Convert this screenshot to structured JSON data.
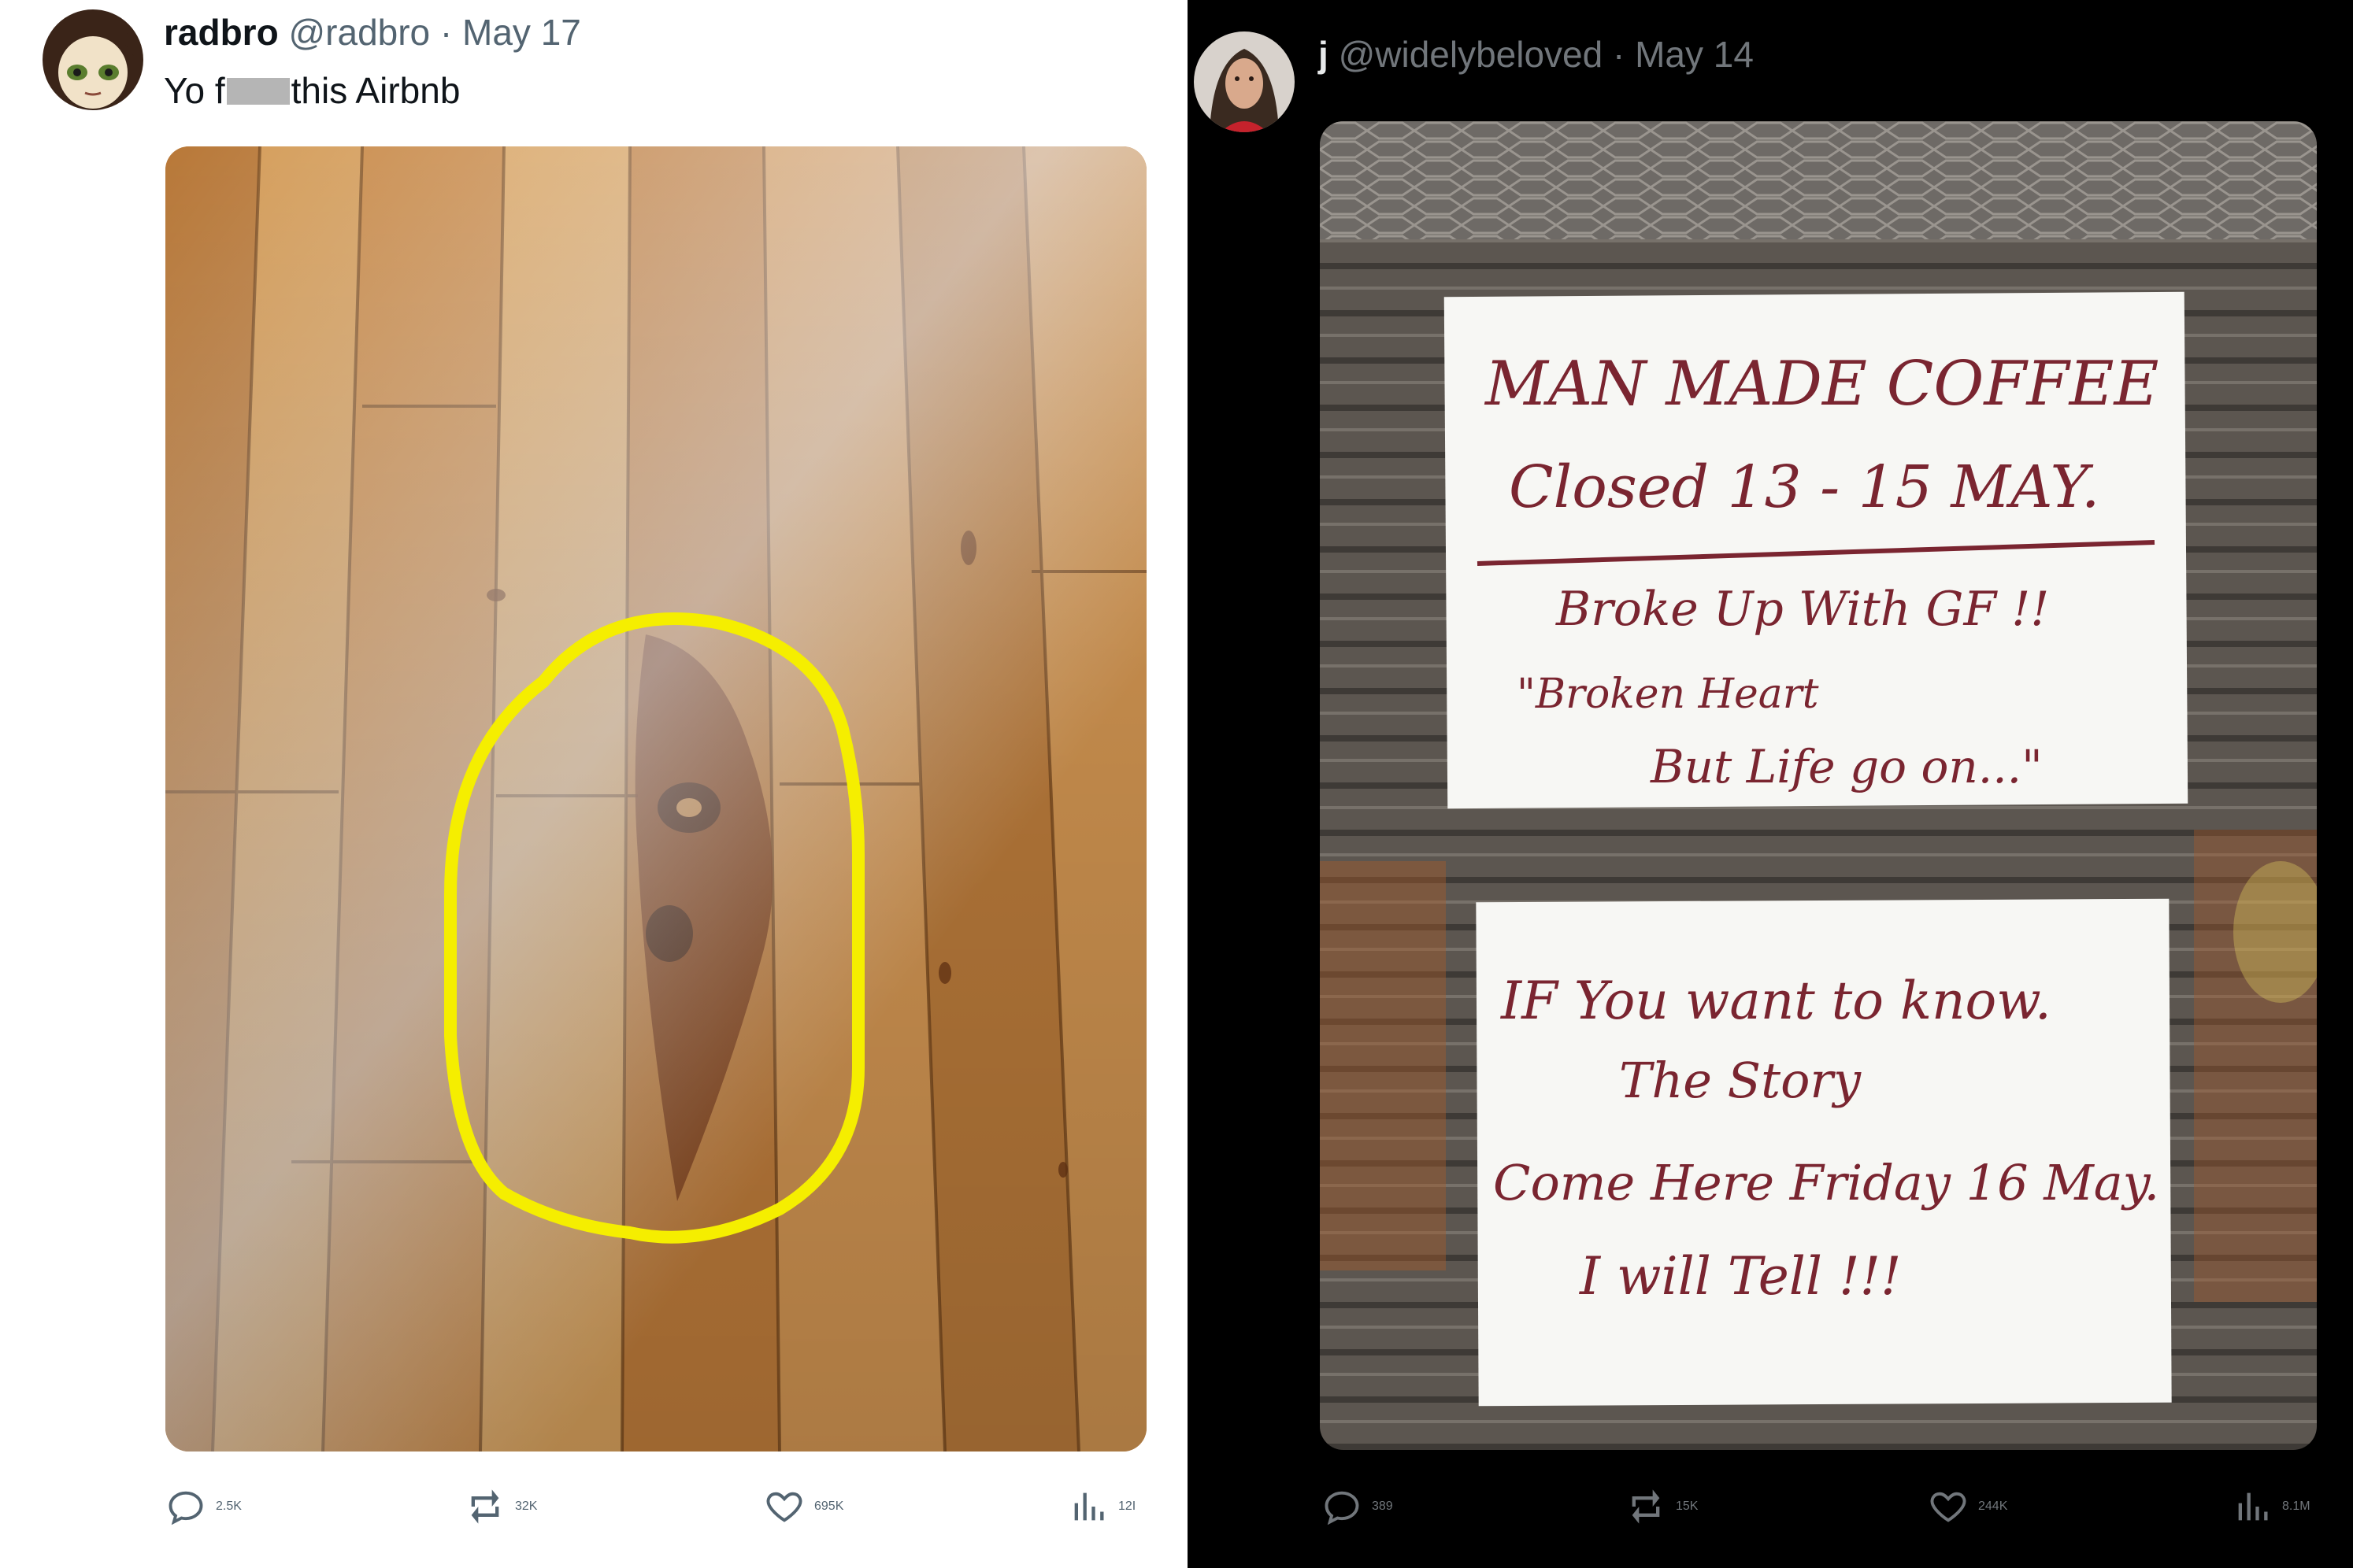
{
  "left_tweet": {
    "display_name": "radbro",
    "handle": "@radbro",
    "date": "· May 17",
    "text_before": "Yo f",
    "text_after": "this Airbnb",
    "image_alt": "Wood plank floor with a yellow-circled knot that looks like a face",
    "actions": {
      "replies": "2.5K",
      "reposts": "32K",
      "likes": "695K",
      "views": "12I"
    }
  },
  "right_tweet": {
    "display_name": "j",
    "handle": "@widelybeloved",
    "date": "· May 14",
    "sign_top": {
      "line1": "MAN MADE COFFEE",
      "line2": "Closed 13 - 15 MAY.",
      "line3": "Broke Up With GF !!",
      "line4": "\"Broken Heart",
      "line5": "But Life go on...\""
    },
    "sign_bottom": {
      "line1": "IF You want to know.",
      "line2": "The Story",
      "line3": "Come Here Friday 16 May.",
      "line4": "I will Tell !!!"
    },
    "actions": {
      "replies": "389",
      "reposts": "15K",
      "likes": "244K",
      "views": "8.1M"
    }
  },
  "colors": {
    "highlight_circle": "#f5ee00",
    "ink": "#7a2530",
    "wood": "#c98a45"
  },
  "icons": {
    "reply": "reply-icon",
    "repost": "repost-icon",
    "like": "heart-icon",
    "views": "views-icon"
  }
}
